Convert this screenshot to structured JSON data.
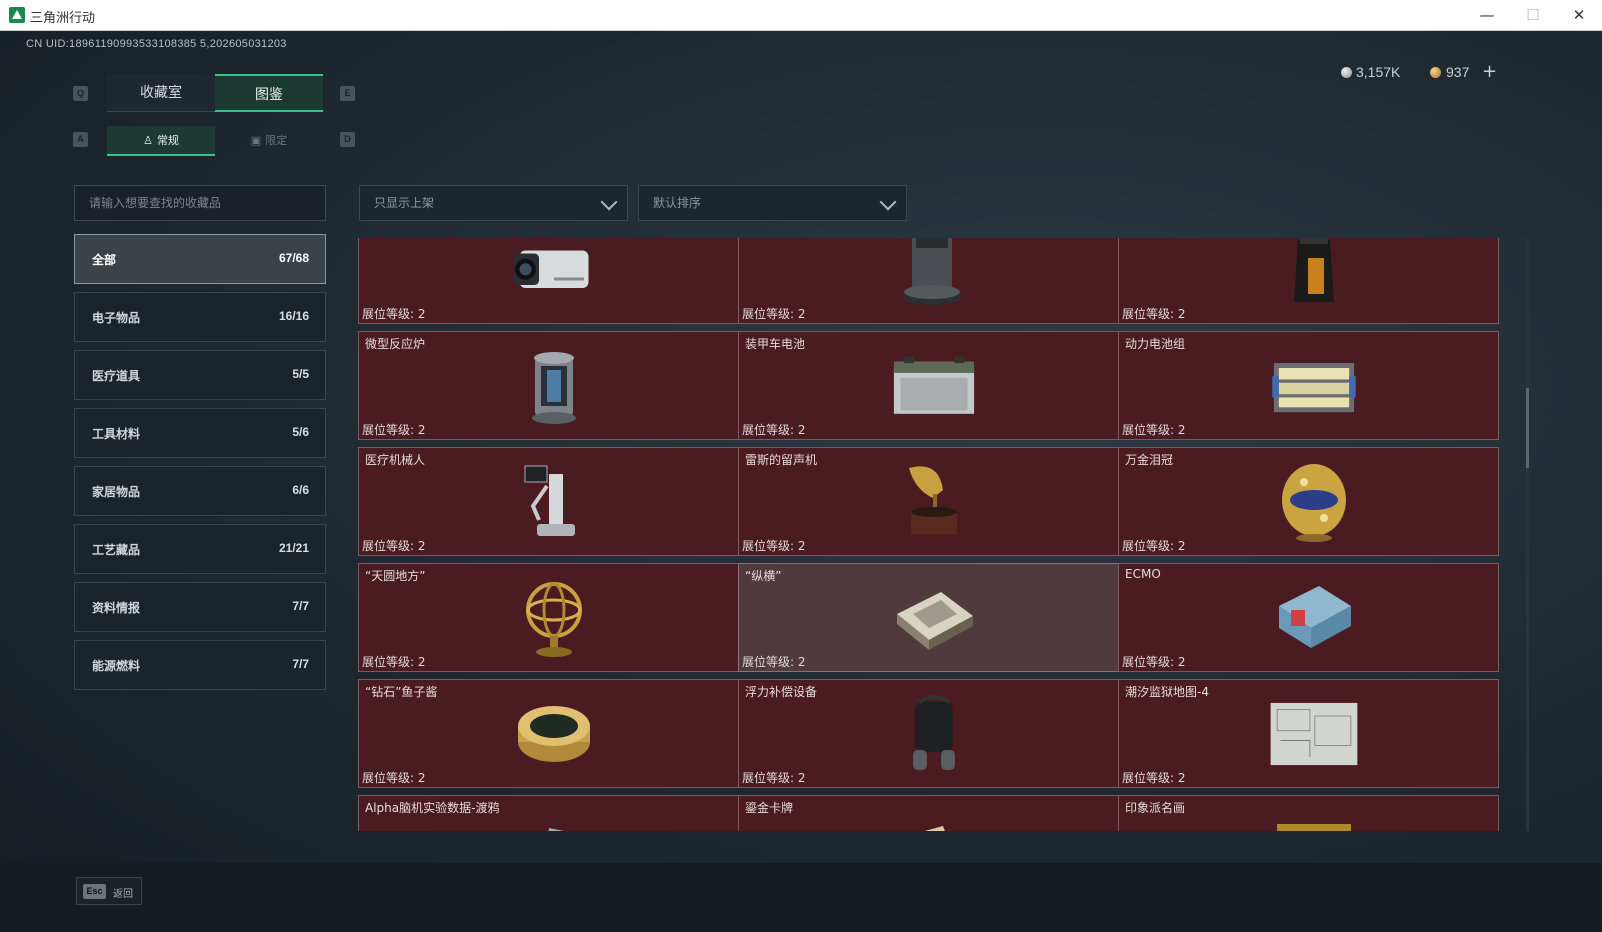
{
  "window": {
    "title": "三角洲行动",
    "minimize": "—",
    "maximize": "☐",
    "close": "✕"
  },
  "header": {
    "uid": "CN UID:18961190993533108385 5,202605031203",
    "silver": "3,157K",
    "gold": "937",
    "plus": "+"
  },
  "tabs": {
    "key_left": "Q",
    "key_right": "E",
    "items": [
      {
        "label": "收藏室"
      },
      {
        "label": "图鉴"
      }
    ]
  },
  "subtabs": {
    "key_left": "A",
    "key_right": "D",
    "items": [
      {
        "label": "常规"
      },
      {
        "label": "限定"
      }
    ]
  },
  "search": {
    "placeholder": "请输入想要查找的收藏品"
  },
  "filters": {
    "shelf": "只显示上架",
    "sort": "默认排序"
  },
  "categories": [
    {
      "label": "全部",
      "count": "67/68"
    },
    {
      "label": "电子物品",
      "count": "16/16"
    },
    {
      "label": "医疗道具",
      "count": "5/5"
    },
    {
      "label": "工具材料",
      "count": "5/6"
    },
    {
      "label": "家居物品",
      "count": "6/6"
    },
    {
      "label": "工艺藏品",
      "count": "21/21"
    },
    {
      "label": "资料情报",
      "count": "7/7"
    },
    {
      "label": "能源燃料",
      "count": "7/7"
    }
  ],
  "items": [
    {
      "name": "",
      "level": "展位等级: 2",
      "icon": "camera-icon"
    },
    {
      "name": "",
      "level": "展位等级: 2",
      "icon": "robot-vacuum-icon"
    },
    {
      "name": "",
      "level": "展位等级: 2",
      "icon": "coffee-bag-icon"
    },
    {
      "name": "微型反应炉",
      "level": "展位等级: 2",
      "icon": "reactor-icon"
    },
    {
      "name": "装甲车电池",
      "level": "展位等级: 2",
      "icon": "battery-icon"
    },
    {
      "name": "动力电池组",
      "level": "展位等级: 2",
      "icon": "battery-pack-icon"
    },
    {
      "name": "医疗机械人",
      "level": "展位等级: 2",
      "icon": "medical-robot-icon"
    },
    {
      "name": "雷斯的留声机",
      "level": "展位等级: 2",
      "icon": "gramophone-icon"
    },
    {
      "name": "万金泪冠",
      "level": "展位等级: 2",
      "icon": "jeweled-egg-icon"
    },
    {
      "name": "“天圆地方”",
      "level": "展位等级: 2",
      "icon": "armillary-sphere-icon"
    },
    {
      "name": "“纵横”",
      "level": "展位等级: 2",
      "icon": "chessboard-icon"
    },
    {
      "name": "ECMO",
      "level": "展位等级: 2",
      "icon": "ecmo-machine-icon"
    },
    {
      "name": "“钻石”鱼子酱",
      "level": "展位等级: 2",
      "icon": "caviar-tin-icon"
    },
    {
      "name": "浮力补偿设备",
      "level": "展位等级: 2",
      "icon": "diving-gear-icon"
    },
    {
      "name": "潮汐监狱地图-4",
      "level": "展位等级: 2",
      "icon": "map-icon"
    },
    {
      "name": "Alpha脑机实验数据-渡鸦",
      "level": "",
      "icon": "data-drive-icon"
    },
    {
      "name": "鎏金卡牌",
      "level": "",
      "icon": "gold-card-icon"
    },
    {
      "name": "印象派名画",
      "level": "",
      "icon": "painting-icon"
    }
  ],
  "footer": {
    "key": "Esc",
    "label": "返回"
  },
  "colors": {
    "accent": "#34c48a",
    "card": "#4a1b21",
    "card_hover": "#513a3d",
    "background": "#1b232a"
  }
}
